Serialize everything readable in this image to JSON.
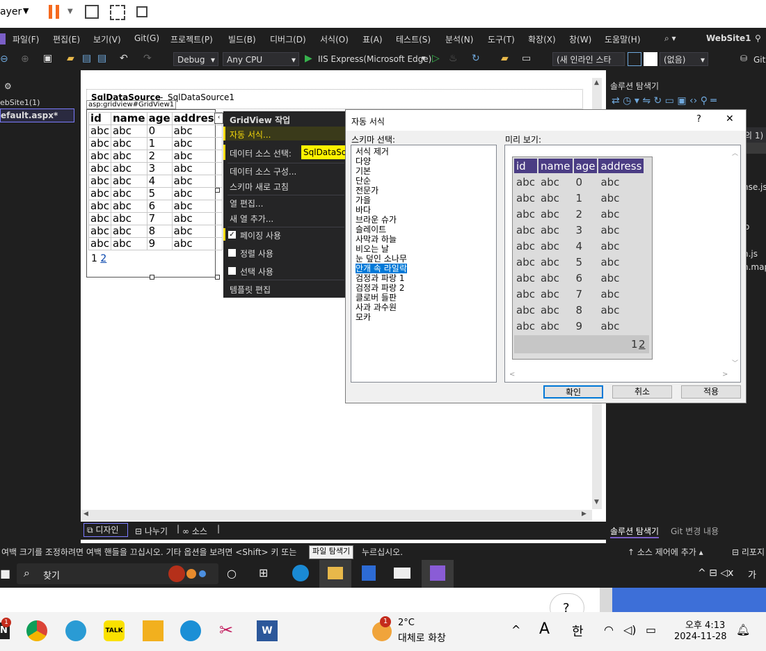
{
  "topstrip": {
    "app_label": "ayer"
  },
  "menu": {
    "items": [
      "파일(F)",
      "편집(E)",
      "보기(V)",
      "Git(G)",
      "프로젝트(P)",
      "빌드(B)",
      "디버그(D)",
      "서식(O)",
      "표(A)",
      "테스트(S)",
      "분석(N)",
      "도구(T)",
      "확장(X)",
      "창(W)",
      "도움말(H)"
    ],
    "solution_name": "WebSite1"
  },
  "toolbar": {
    "config": "Debug",
    "platform": "Any CPU",
    "run_target": "IIS Express(Microsoft Edge)",
    "inline_style": "(새 인라인 스타",
    "none_combo": "(없음)",
    "git_label": "Git"
  },
  "left_panel": {
    "project": "ebSite1(1)",
    "file": "efault.aspx*"
  },
  "designer": {
    "datasource_label": "SqlDataSource",
    "datasource_name": "SqlDataSource1",
    "gridview_tag": "asp:gridview#GridView1",
    "columns": [
      "id",
      "name",
      "age",
      "address"
    ],
    "rows": [
      [
        "abc",
        "abc",
        "0",
        "abc"
      ],
      [
        "abc",
        "abc",
        "1",
        "abc"
      ],
      [
        "abc",
        "abc",
        "2",
        "abc"
      ],
      [
        "abc",
        "abc",
        "3",
        "abc"
      ],
      [
        "abc",
        "abc",
        "4",
        "abc"
      ],
      [
        "abc",
        "abc",
        "5",
        "abc"
      ],
      [
        "abc",
        "abc",
        "6",
        "abc"
      ],
      [
        "abc",
        "abc",
        "7",
        "abc"
      ],
      [
        "abc",
        "abc",
        "8",
        "abc"
      ],
      [
        "abc",
        "abc",
        "9",
        "abc"
      ]
    ],
    "pager_current": "1",
    "pager_link": "2"
  },
  "tasks": {
    "title": "GridView 작업",
    "auto_format": "자동 서식...",
    "choose_ds": "데이터 소스 선택:",
    "ds_value": "SqlDataSou",
    "configure_ds": "데이터 소스 구성...",
    "refresh_schema": "스키마 새로 고침",
    "edit_columns": "열 편집...",
    "add_column": "새 열 추가...",
    "enable_paging": "페이징 사용",
    "enable_sorting": "정렬 사용",
    "enable_selection": "선택 사용",
    "edit_templates": "템플릿 편집",
    "paging_checked": true,
    "sorting_checked": false,
    "selection_checked": false
  },
  "dialog": {
    "title": "자동 서식",
    "help": "?",
    "close": "✕",
    "schema_label": "스키마 선택:",
    "preview_label": "미리 보기:",
    "schemes": [
      "서식 제거",
      "다양",
      "기본",
      "단순",
      "전문가",
      "가을",
      "바다",
      "브라운 슈가",
      "슬레이트",
      "사막과 하늘",
      "비오는 날",
      "눈 덮인 소나무",
      "안개 속 라일락",
      "검정과 파랑 1",
      "검정과 파랑 2",
      "클로버 들판",
      "사과 과수원",
      "모카"
    ],
    "selected_scheme": "안개 속 라일락",
    "preview_columns": [
      "id",
      "name",
      "age",
      "address"
    ],
    "preview_rows": [
      [
        "abc",
        "abc",
        "0",
        "abc"
      ],
      [
        "abc",
        "abc",
        "1",
        "abc"
      ],
      [
        "abc",
        "abc",
        "2",
        "abc"
      ],
      [
        "abc",
        "abc",
        "3",
        "abc"
      ],
      [
        "abc",
        "abc",
        "4",
        "abc"
      ],
      [
        "abc",
        "abc",
        "5",
        "abc"
      ],
      [
        "abc",
        "abc",
        "6",
        "abc"
      ],
      [
        "abc",
        "abc",
        "7",
        "abc"
      ],
      [
        "abc",
        "abc",
        "8",
        "abc"
      ],
      [
        "abc",
        "abc",
        "9",
        "abc"
      ]
    ],
    "preview_pager_current": "1",
    "preview_pager_link": "2",
    "ok": "확인",
    "cancel": "취소",
    "apply": "적용"
  },
  "right_panel": {
    "title": "솔루션 탐색기",
    "partial_1": "의 1)",
    "partial_2": "nse.js",
    "partial_3": "o",
    "partial_4": "n.js",
    "partial_5": "n.map"
  },
  "bottom_tabs": {
    "design": "디자인",
    "split": "나누기",
    "source": "소스",
    "solution_explorer": "솔루션 탐색기",
    "git_changes": "Git 변경 내용"
  },
  "status": {
    "message": "여백 크기를 조정하려면 여백 핸들을 끄십시오. 기타 옵션을 보려면 <Shift> 키 또는",
    "message_tail": "누르십시오.",
    "tooltip": "파일 탐색기",
    "source_control": "소스 제어에 추가",
    "repo": "리포지"
  },
  "taskbar": {
    "search": "찾기",
    "ime": "가",
    "weather_temp": "2°C",
    "weather_text": "대체로 화창",
    "notification_count": "1",
    "weather_badge": "1",
    "lang_a": "A",
    "lang_han": "한",
    "time": "오후 4:13",
    "date": "2024-11-28",
    "help_bubble": "?"
  }
}
